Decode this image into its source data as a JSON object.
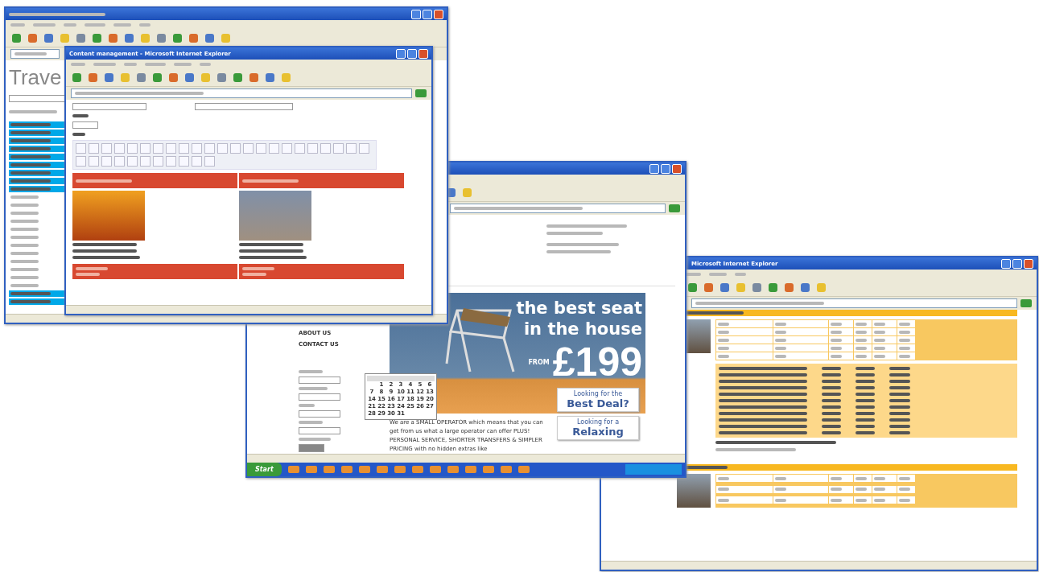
{
  "travel_window": {
    "heading": "Trave"
  },
  "editor_window": {
    "title": "Content management - Microsoft Internet Explorer"
  },
  "offer_window": {
    "nav": [
      "ABOUT US",
      "CONTACT US"
    ],
    "banner": {
      "line1": "the best seat",
      "line2": "in the house",
      "from": "FROM",
      "price": "£199"
    },
    "promos": [
      {
        "line1": "Looking for the",
        "line2": "Best Deal?"
      },
      {
        "line1": "Looking for a",
        "line2": "Relaxing"
      }
    ],
    "intro": "We are a SMALL OPERATOR which means that you can get from us what a large operator can offer PLUS! PERSONAL SERVICE, SHORTER TRANSFERS & SIMPLER PRICING with no hidden extras like",
    "calendar": {
      "days": [
        "1",
        "2",
        "3",
        "4",
        "5",
        "6",
        "7",
        "8",
        "9",
        "10",
        "11",
        "12",
        "13",
        "14",
        "15",
        "16",
        "17",
        "18",
        "19",
        "20",
        "21",
        "22",
        "23",
        "24",
        "25",
        "26",
        "27",
        "28",
        "29",
        "30",
        "31"
      ]
    },
    "taskbar": {
      "start": "Start"
    }
  },
  "hotel_window": {
    "title": "Microsoft Internet Explorer"
  }
}
